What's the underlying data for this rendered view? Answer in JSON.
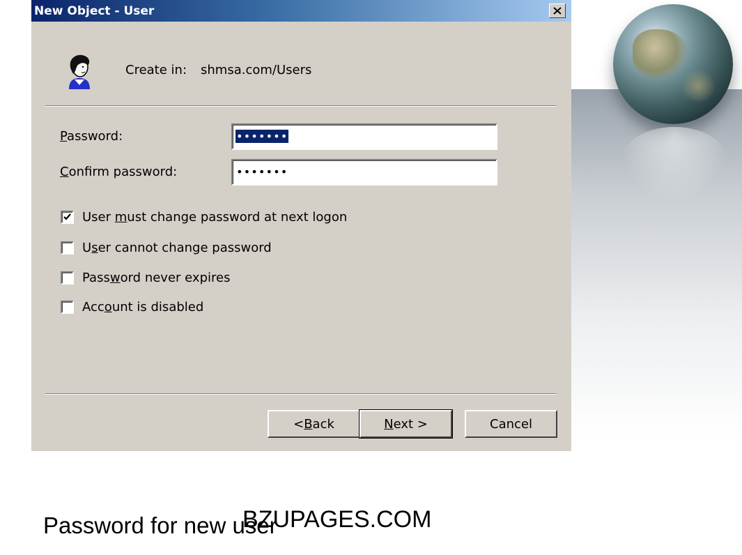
{
  "window": {
    "title": "New Object - User"
  },
  "header": {
    "create_in_label": "Create in:",
    "create_in_value": "shmsa.com/Users"
  },
  "form": {
    "password": {
      "label_key": "P",
      "label_rest": "assword:",
      "value": "•••••••"
    },
    "confirm": {
      "label_key": "C",
      "label_rest": "onfirm password:",
      "value": "•••••••"
    }
  },
  "options": [
    {
      "pre": "User ",
      "key": "m",
      "post": "ust change password at next logon",
      "checked": true
    },
    {
      "pre": "U",
      "key": "s",
      "post": "er cannot change password",
      "checked": false
    },
    {
      "pre": "Pass",
      "key": "w",
      "post": "ord never expires",
      "checked": false
    },
    {
      "pre": "Acc",
      "key": "o",
      "post": "unt is disabled",
      "checked": false
    }
  ],
  "buttons": {
    "back": {
      "pre": "< ",
      "key": "B",
      "post": "ack"
    },
    "next": {
      "pre": "",
      "key": "N",
      "post": "ext >"
    },
    "cancel": "Cancel"
  },
  "slide": {
    "caption": "Password for new user",
    "watermark": "BZUPAGES.COM"
  },
  "icons": {
    "close": "close-icon",
    "user": "user-icon",
    "check": "check-icon",
    "globe": "globe-image"
  }
}
